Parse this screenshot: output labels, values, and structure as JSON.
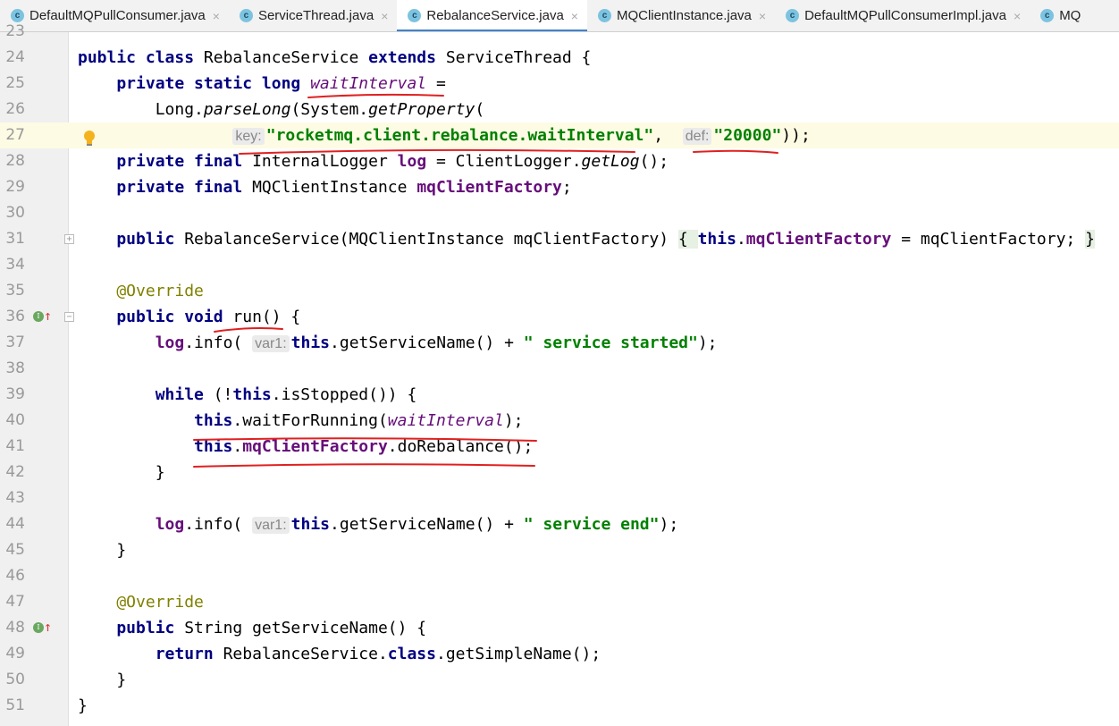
{
  "tabs": [
    {
      "label": "DefaultMQPullConsumer.java",
      "active": false
    },
    {
      "label": "ServiceThread.java",
      "active": false
    },
    {
      "label": "RebalanceService.java",
      "active": true
    },
    {
      "label": "MQClientInstance.java",
      "active": false
    },
    {
      "label": "DefaultMQPullConsumerImpl.java",
      "active": false
    },
    {
      "label": "MQ",
      "active": false
    }
  ],
  "tab_close_glyph": "×",
  "tab_icon_letter": "c",
  "lines": [
    {
      "num": "23",
      "tokens": []
    },
    {
      "num": "24",
      "tokens": [
        [
          "public class ",
          "k"
        ],
        [
          "RebalanceService ",
          ""
        ],
        [
          "extends ",
          "k"
        ],
        [
          "ServiceThread {",
          ""
        ]
      ]
    },
    {
      "num": "25",
      "tokens": [
        [
          "    private static long ",
          "k"
        ],
        [
          "waitInterval",
          "fi"
        ],
        [
          " =",
          ""
        ]
      ]
    },
    {
      "num": "26",
      "tokens": [
        [
          "        Long.",
          ""
        ],
        [
          "parseLong",
          "m"
        ],
        [
          "(System.",
          ""
        ],
        [
          "getProperty",
          "m"
        ],
        [
          "(",
          ""
        ]
      ]
    },
    {
      "num": "27",
      "hl": true,
      "bulb": true,
      "tokens": [
        [
          "                ",
          ""
        ],
        [
          "key:",
          "h"
        ],
        [
          "\"rocketmq.client.rebalance.waitInterval\"",
          "s"
        ],
        [
          ",  ",
          ""
        ],
        [
          "def:",
          "h"
        ],
        [
          "\"20000\"",
          "s"
        ],
        [
          "));",
          ""
        ]
      ]
    },
    {
      "num": "28",
      "tokens": [
        [
          "    private final ",
          "k"
        ],
        [
          "InternalLogger ",
          ""
        ],
        [
          "log",
          "f"
        ],
        [
          " = ClientLogger.",
          ""
        ],
        [
          "getLog",
          "m"
        ],
        [
          "();",
          ""
        ]
      ]
    },
    {
      "num": "29",
      "tokens": [
        [
          "    private final ",
          "k"
        ],
        [
          "MQClientInstance ",
          ""
        ],
        [
          "mqClientFactory",
          "f"
        ],
        [
          ";",
          ""
        ]
      ]
    },
    {
      "num": "30",
      "tokens": []
    },
    {
      "num": "31",
      "fold": "+",
      "tokens": [
        [
          "    public ",
          "k"
        ],
        [
          "RebalanceService(MQClientInstance mqClientFactory) ",
          ""
        ],
        [
          "{ ",
          "fb"
        ],
        [
          "this",
          "k"
        ],
        [
          ".",
          ""
        ],
        [
          "mqClientFactory",
          "f"
        ],
        [
          " = mqClientFactory; ",
          ""
        ],
        [
          "}",
          "fb"
        ]
      ]
    },
    {
      "num": "34",
      "tokens": []
    },
    {
      "num": "35",
      "tokens": [
        [
          "    @Override",
          "a"
        ]
      ]
    },
    {
      "num": "36",
      "impl": true,
      "fold": "−",
      "tokens": [
        [
          "    public void ",
          "k"
        ],
        [
          "run() {",
          ""
        ]
      ]
    },
    {
      "num": "37",
      "tokens": [
        [
          "        log",
          "f"
        ],
        [
          ".info( ",
          ""
        ],
        [
          "var1:",
          "h"
        ],
        [
          "this",
          "k"
        ],
        [
          ".getServiceName() + ",
          ""
        ],
        [
          "\" service started\"",
          "s"
        ],
        [
          ");",
          ""
        ]
      ]
    },
    {
      "num": "38",
      "tokens": []
    },
    {
      "num": "39",
      "tokens": [
        [
          "        while ",
          "k"
        ],
        [
          "(!",
          ""
        ],
        [
          "this",
          "k"
        ],
        [
          ".isStopped()) {",
          ""
        ]
      ]
    },
    {
      "num": "40",
      "tokens": [
        [
          "            this",
          "k"
        ],
        [
          ".waitForRunning(",
          ""
        ],
        [
          "waitInterval",
          "fi"
        ],
        [
          ");",
          ""
        ]
      ]
    },
    {
      "num": "41",
      "tokens": [
        [
          "            this",
          "k"
        ],
        [
          ".",
          ""
        ],
        [
          "mqClientFactory",
          "f"
        ],
        [
          ".doRebalance();",
          ""
        ]
      ]
    },
    {
      "num": "42",
      "tokens": [
        [
          "        }",
          ""
        ]
      ]
    },
    {
      "num": "43",
      "tokens": []
    },
    {
      "num": "44",
      "tokens": [
        [
          "        log",
          "f"
        ],
        [
          ".info( ",
          ""
        ],
        [
          "var1:",
          "h"
        ],
        [
          "this",
          "k"
        ],
        [
          ".getServiceName() + ",
          ""
        ],
        [
          "\" service end\"",
          "s"
        ],
        [
          ");",
          ""
        ]
      ]
    },
    {
      "num": "45",
      "tokens": [
        [
          "    }",
          ""
        ]
      ]
    },
    {
      "num": "46",
      "tokens": []
    },
    {
      "num": "47",
      "tokens": [
        [
          "    @Override",
          "a"
        ]
      ]
    },
    {
      "num": "48",
      "impl": true,
      "tokens": [
        [
          "    public ",
          "k"
        ],
        [
          "String getServiceName() {",
          ""
        ]
      ]
    },
    {
      "num": "49",
      "tokens": [
        [
          "        return ",
          "k"
        ],
        [
          "RebalanceService.",
          ""
        ],
        [
          "class",
          "k"
        ],
        [
          ".getSimpleName();",
          ""
        ]
      ]
    },
    {
      "num": "50",
      "tokens": [
        [
          "    }",
          ""
        ]
      ]
    },
    {
      "num": "51",
      "tokens": [
        [
          "}",
          ""
        ]
      ]
    }
  ],
  "colors": {
    "keyword": "#000080",
    "field": "#660e7a",
    "string": "#008000",
    "annotation": "#808000",
    "annotation_mark": "#e02020",
    "active_tab": "#4083c9"
  }
}
